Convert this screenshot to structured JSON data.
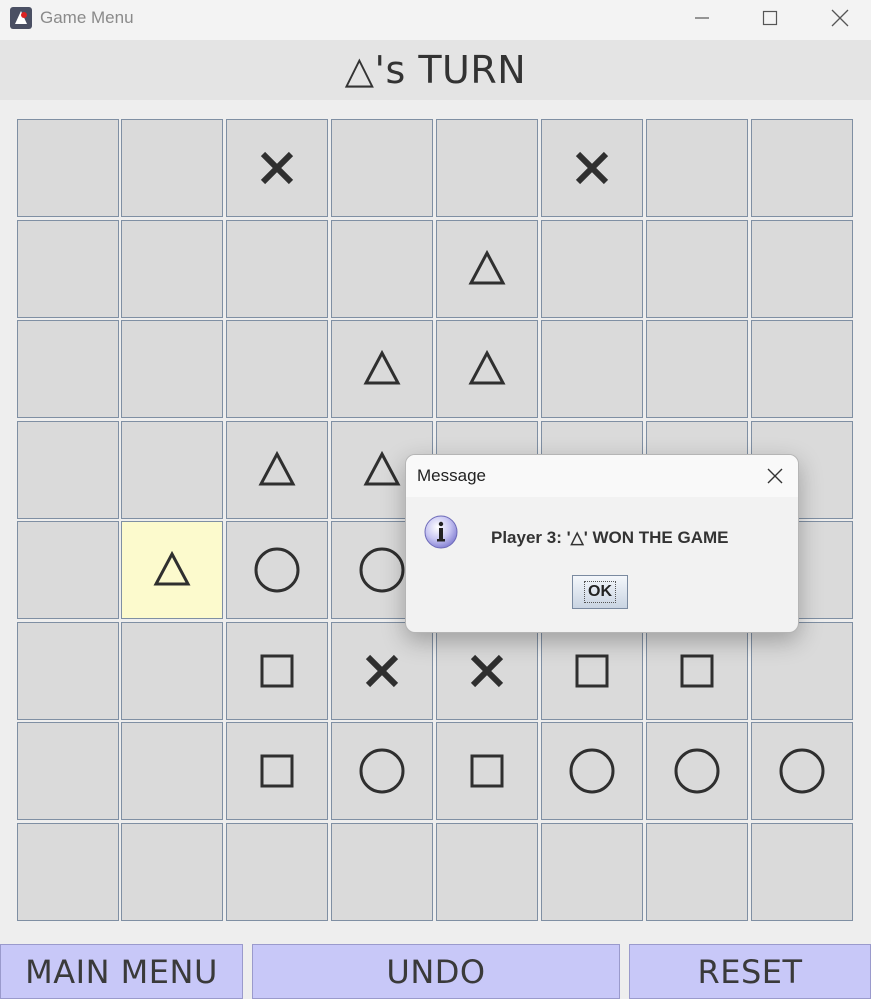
{
  "window": {
    "title": "Game Menu"
  },
  "header": {
    "turn_text": "△'s TURN"
  },
  "board": {
    "highlight_color": "#fcfacd",
    "rows": [
      [
        "",
        "",
        "X",
        "",
        "",
        "X",
        "",
        ""
      ],
      [
        "",
        "",
        "",
        "",
        "△",
        "",
        "",
        ""
      ],
      [
        "",
        "",
        "",
        "△",
        "△",
        "",
        "",
        ""
      ],
      [
        "",
        "",
        "△",
        "△",
        "",
        "",
        "",
        ""
      ],
      [
        "",
        "△",
        "O",
        "O",
        "",
        "",
        "",
        ""
      ],
      [
        "",
        "",
        "□",
        "X",
        "X",
        "□",
        "□",
        ""
      ],
      [
        "",
        "",
        "□",
        "O",
        "□",
        "O",
        "O",
        "O"
      ],
      [
        "",
        "",
        "",
        "",
        "",
        "",
        "",
        ""
      ]
    ],
    "highlighted_cell": {
      "row": 4,
      "col": 1
    }
  },
  "dialog": {
    "title": "Message",
    "message": "Player 3: '△' WON THE GAME",
    "ok_label": "OK",
    "icon": "info-icon"
  },
  "buttons": {
    "main_menu": "MAIN MENU",
    "undo": "UNDO",
    "reset": "RESET",
    "color": "#c8c8f8"
  }
}
